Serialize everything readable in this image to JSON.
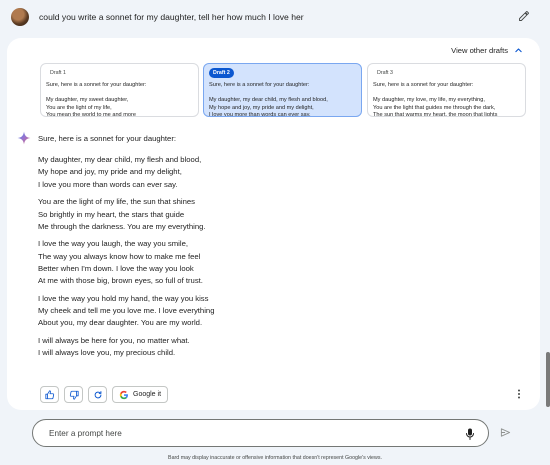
{
  "prompt": {
    "text": "could you write a sonnet for my daughter, tell her how much I love her"
  },
  "drafts_toggle": {
    "label": "View other drafts"
  },
  "drafts": [
    {
      "label": "Draft 1",
      "text": "Sure, here is a sonnet for your daughter:\n\nMy daughter, my sweet daughter,\nYou are the light of my life,\nYou mean the world to me and more"
    },
    {
      "label": "Draft 2",
      "text": "Sure, here is a sonnet for your daughter:\n\nMy daughter, my dear child, my flesh and blood,\nMy hope and joy, my pride and my delight,\nI love you more than words can ever say."
    },
    {
      "label": "Draft 3",
      "text": "Sure, here is a sonnet for your daughter:\n\nMy daughter, my love, my life, my everything,\nYou are the light that guides me through the dark,\nThe sun that warms my heart, the moon that lights"
    }
  ],
  "response": {
    "intro": "Sure, here is a sonnet for your daughter:",
    "stanzas": [
      [
        "My daughter, my dear child, my flesh and blood,",
        "My hope and joy, my pride and my delight,",
        "I love you more than words can ever say."
      ],
      [
        "You are the light of my life, the sun that shines",
        "So brightly in my heart, the stars that guide",
        "Me through the darkness. You are my everything."
      ],
      [
        "I love the way you laugh, the way you smile,",
        "The way you always know how to make me feel",
        "Better when I'm down. I love the way you look",
        "At me with those big, brown eyes, so full of trust."
      ],
      [
        "I love the way you hold my hand, the way you kiss",
        "My cheek and tell me you love me. I love everything",
        "About you, my dear daughter. You are my world."
      ],
      [
        "I will always be here for you, no matter what.",
        "I will always love you, my precious child."
      ]
    ]
  },
  "actions": {
    "google_it": "Google it"
  },
  "input": {
    "placeholder": "Enter a prompt here"
  },
  "disclaimer": "Bard may display inaccurate or offensive information that doesn't represent Google's views.",
  "colors": {
    "page_bg": "#f0f4f9",
    "active_draft_bg": "#d3e3fd",
    "accent_blue": "#0b57d0"
  },
  "icons": [
    "user-avatar",
    "edit-icon",
    "chevron-up-icon",
    "sparkle-icon",
    "thumbs-up-icon",
    "thumbs-down-icon",
    "regenerate-icon",
    "google-icon",
    "more-vert-icon",
    "mic-icon",
    "send-icon"
  ]
}
